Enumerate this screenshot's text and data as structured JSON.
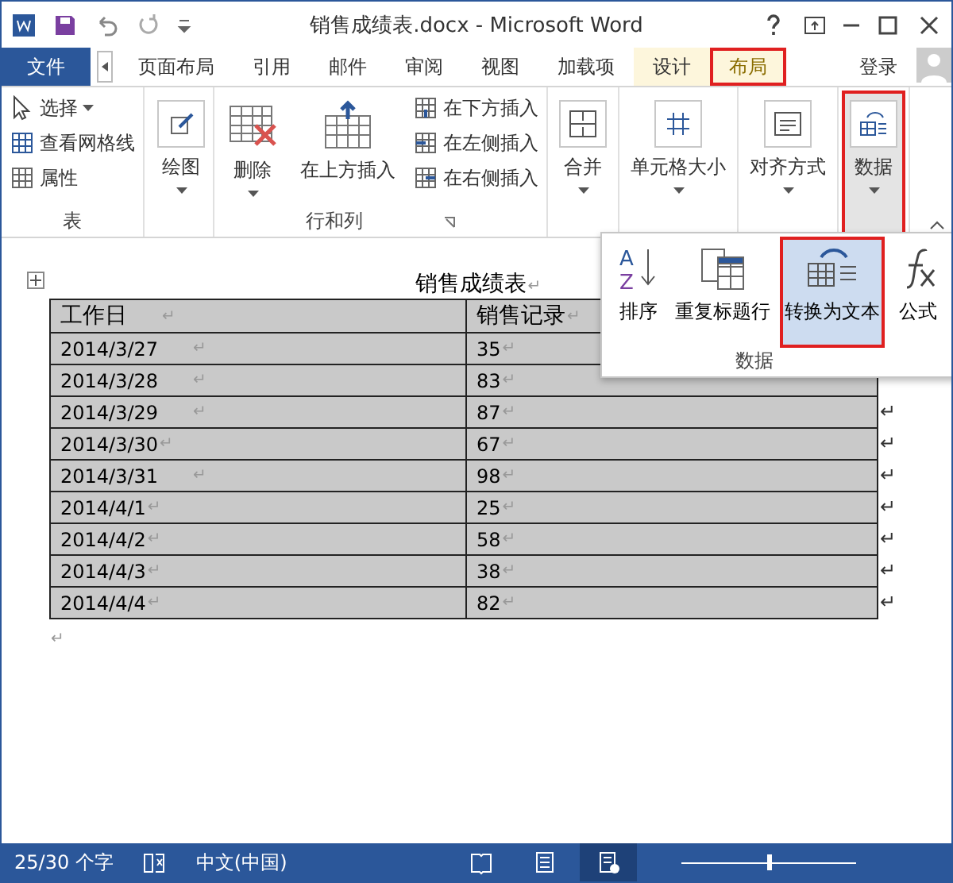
{
  "window": {
    "title": "销售成绩表.docx - Microsoft Word"
  },
  "tabs": [
    {
      "label": "文件",
      "kind": "file",
      "selected": false
    },
    {
      "label": "页面布局",
      "kind": "normal",
      "selected": false
    },
    {
      "label": "引用",
      "kind": "normal",
      "selected": false
    },
    {
      "label": "邮件",
      "kind": "normal",
      "selected": false
    },
    {
      "label": "审阅",
      "kind": "normal",
      "selected": false
    },
    {
      "label": "视图",
      "kind": "normal",
      "selected": false
    },
    {
      "label": "加载项",
      "kind": "normal",
      "selected": false
    },
    {
      "label": "设计",
      "kind": "context",
      "selected": false
    },
    {
      "label": "布局",
      "kind": "context",
      "selected": true
    }
  ],
  "account": {
    "label": "登录"
  },
  "ribbon": {
    "table_group": {
      "label": "表",
      "items": [
        {
          "label": "选择",
          "dropdown": true
        },
        {
          "label": "查看网格线",
          "dropdown": false
        },
        {
          "label": "属性",
          "dropdown": false
        }
      ]
    },
    "draw": {
      "label": "绘图"
    },
    "rows_cols": {
      "label": "行和列",
      "delete": "删除",
      "insert_above": "在上方插入",
      "small": [
        "在下方插入",
        "在左侧插入",
        "在右侧插入"
      ]
    },
    "collapsed": [
      {
        "label": "合并",
        "highlighted": false
      },
      {
        "label": "单元格大小",
        "highlighted": false
      },
      {
        "label": "对齐方式",
        "highlighted": false
      },
      {
        "label": "数据",
        "highlighted": true
      }
    ]
  },
  "dropdown": {
    "label": "数据",
    "items": [
      {
        "label": "排序",
        "highlighted": false,
        "icon_letters": [
          "A",
          "Z"
        ]
      },
      {
        "label": "重复标题行",
        "highlighted": false
      },
      {
        "label": "转换为文本",
        "highlighted": true
      },
      {
        "label": "公式",
        "highlighted": false
      }
    ]
  },
  "document": {
    "title": "销售成绩表",
    "title_mark": "↵",
    "end_mark": "↵",
    "columns": [
      {
        "label": "工作日",
        "mark": "↵",
        "tabbed": true
      },
      {
        "label": "销售记录",
        "mark": "↵",
        "tabbed": false
      }
    ],
    "rows": [
      {
        "date": "2014/3/27",
        "date_tabbed": true,
        "value": "35",
        "end_mark": false
      },
      {
        "date": "2014/3/28",
        "date_tabbed": true,
        "value": "83",
        "end_mark": false
      },
      {
        "date": "2014/3/29",
        "date_tabbed": true,
        "value": "87",
        "end_mark": true
      },
      {
        "date": "2014/3/30",
        "date_tabbed": false,
        "value": "67",
        "end_mark": true
      },
      {
        "date": "2014/3/31",
        "date_tabbed": true,
        "value": "98",
        "end_mark": true
      },
      {
        "date": "2014/4/1",
        "date_tabbed": false,
        "value": "25",
        "end_mark": true
      },
      {
        "date": "2014/4/2",
        "date_tabbed": false,
        "value": "58",
        "end_mark": true
      },
      {
        "date": "2014/4/3",
        "date_tabbed": false,
        "value": "38",
        "end_mark": true
      },
      {
        "date": "2014/4/4",
        "date_tabbed": false,
        "value": "82",
        "end_mark": true
      }
    ],
    "mark": "↵"
  },
  "status_bar": {
    "word_count": "25/30 个字",
    "language": "中文(中国)",
    "views": [
      {
        "kind": "read",
        "selected": false
      },
      {
        "kind": "print",
        "selected": false
      },
      {
        "kind": "web",
        "selected": true
      }
    ],
    "zoom": {
      "level": 0.5
    }
  }
}
